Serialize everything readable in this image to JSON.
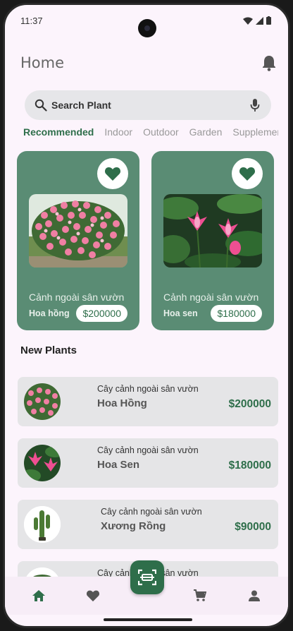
{
  "status_bar": {
    "time": "11:37"
  },
  "header": {
    "title": "Home"
  },
  "search": {
    "placeholder": "Search Plant"
  },
  "categories": [
    "Recommended",
    "Indoor",
    "Outdoor",
    "Garden",
    "Supplement"
  ],
  "featured": [
    {
      "subtitle": "Cảnh ngoài sân vườn",
      "name": "Hoa hồng",
      "price": "$200000"
    },
    {
      "subtitle": "Cảnh ngoài sân vườn",
      "name": "Hoa sen",
      "price": "$180000"
    }
  ],
  "new_plants": {
    "title": "New Plants",
    "items": [
      {
        "subtitle": "Cây cảnh ngoài sân vườn",
        "name": "Hoa Hồng",
        "price": "$200000"
      },
      {
        "subtitle": "Cây cảnh ngoài sân vườn",
        "name": "Hoa Sen",
        "price": "$180000"
      },
      {
        "subtitle": "Cây cảnh ngoài sân vườn",
        "name": "Xương Rồng",
        "price": "$90000"
      },
      {
        "subtitle": "Cây cảnh ngoài sân vườn",
        "name": "",
        "price": ""
      }
    ]
  },
  "bottom_nav": [
    "home-icon",
    "heart-icon",
    "scan-icon",
    "cart-icon",
    "person-icon"
  ],
  "colors": {
    "accent": "#2e6e4a",
    "card": "#5a8c74",
    "background": "#fcf4fc"
  }
}
